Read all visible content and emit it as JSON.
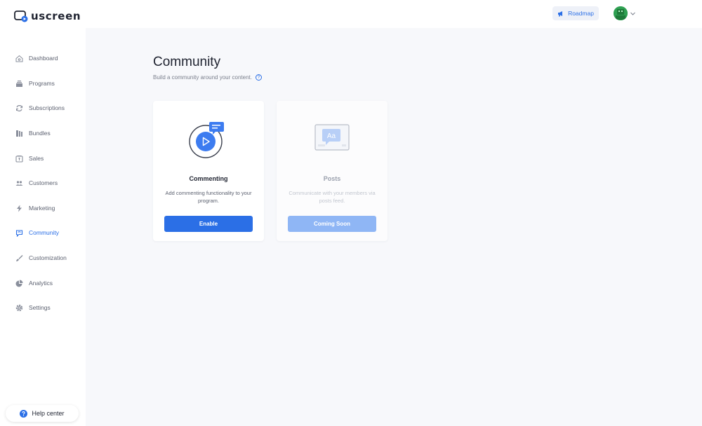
{
  "brand": {
    "name": "uscreen",
    "icon": "play-monitor-icon"
  },
  "header": {
    "roadmap_label": "Roadmap",
    "roadmap_icon": "megaphone-icon",
    "account_icon": "chevron-down-icon"
  },
  "sidebar": {
    "items": [
      {
        "label": "Dashboard",
        "icon": "home-icon"
      },
      {
        "label": "Programs",
        "icon": "stack-icon"
      },
      {
        "label": "Subscriptions",
        "icon": "refresh-icon"
      },
      {
        "label": "Bundles",
        "icon": "bundles-icon"
      },
      {
        "label": "Sales",
        "icon": "price-tag-icon"
      },
      {
        "label": "Customers",
        "icon": "people-icon"
      },
      {
        "label": "Marketing",
        "icon": "bolt-icon"
      },
      {
        "label": "Community",
        "icon": "chat-icon"
      },
      {
        "label": "Customization",
        "icon": "brush-icon"
      },
      {
        "label": "Analytics",
        "icon": "pie-chart-icon"
      },
      {
        "label": "Settings",
        "icon": "gear-icon"
      }
    ],
    "active": "Community",
    "help_label": "Help center"
  },
  "main": {
    "title": "Community",
    "subtitle": "Build a community around your content.",
    "cards": [
      {
        "title": "Commenting",
        "description": "Add commenting functionality to your program.",
        "button": "Enable",
        "illustration": "commenting-illustration"
      },
      {
        "title": "Posts",
        "description": "Communicate with your members via posts feed.",
        "button": "Coming Soon",
        "illustration": "posts-illustration",
        "illustration_text": "Aa"
      }
    ]
  },
  "colors": {
    "accent": "#2b6fe6",
    "accent_soft": "#8fb6f5",
    "background": "#f7f8fb",
    "text": "#1f2330"
  }
}
